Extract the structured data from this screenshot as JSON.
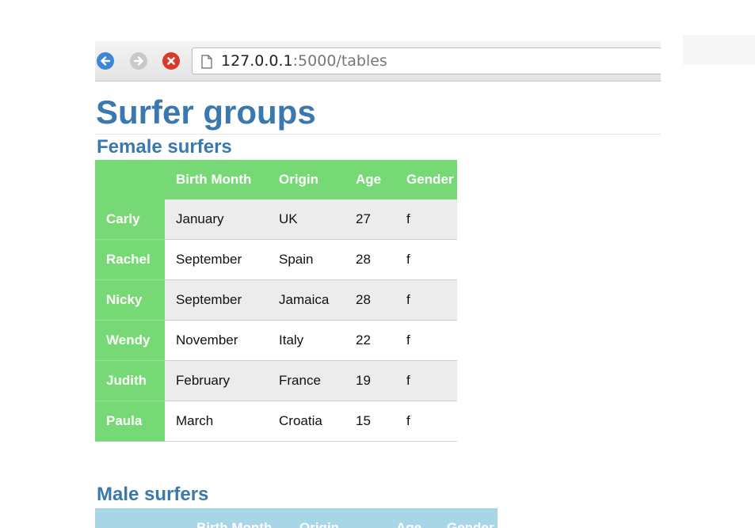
{
  "browser": {
    "url_host": "127.0.0.1",
    "url_rest": ":5000/tables"
  },
  "icons": {
    "back": "back-arrow-icon",
    "forward": "forward-arrow-icon",
    "stop": "stop-x-icon",
    "page": "page-icon"
  },
  "colors": {
    "heading": "#3a78ad",
    "female_header": "#77d975",
    "male_header": "#a8d6e6",
    "stripe": "#ececec"
  },
  "page": {
    "title": "Surfer groups"
  },
  "female": {
    "title": "Female surfers",
    "columns": [
      "",
      "Birth Month",
      "Origin",
      "Age",
      "Gender"
    ],
    "rows": [
      {
        "name": "Carly",
        "month": "January",
        "origin": "UK",
        "age": "27",
        "gender": "f"
      },
      {
        "name": "Rachel",
        "month": "September",
        "origin": "Spain",
        "age": "28",
        "gender": "f"
      },
      {
        "name": "Nicky",
        "month": "September",
        "origin": "Jamaica",
        "age": "28",
        "gender": "f"
      },
      {
        "name": "Wendy",
        "month": "November",
        "origin": "Italy",
        "age": "22",
        "gender": "f"
      },
      {
        "name": "Judith",
        "month": "February",
        "origin": "France",
        "age": "19",
        "gender": "f"
      },
      {
        "name": "Paula",
        "month": "March",
        "origin": "Croatia",
        "age": "15",
        "gender": "f"
      }
    ]
  },
  "male": {
    "title": "Male surfers",
    "columns": [
      "",
      "Birth Month",
      "Origin",
      "Age",
      "Gender"
    ]
  }
}
